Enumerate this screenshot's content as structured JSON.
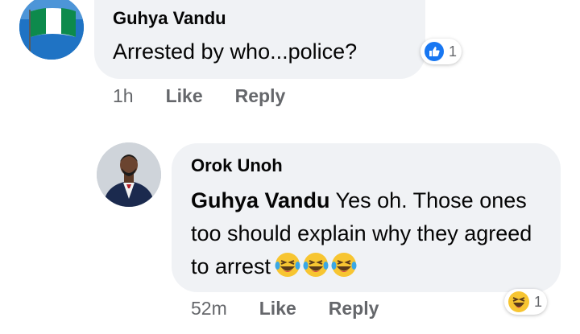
{
  "comments": [
    {
      "author": "Guhya Vandu",
      "text": "Arrested by who...police?",
      "reaction": {
        "type": "like-icon",
        "count": "1"
      },
      "time": "1h",
      "like_label": "Like",
      "reply_label": "Reply"
    },
    {
      "author": "Orok Unoh",
      "mention": "Guhya Vandu",
      "text": " Yes oh. Those ones too should explain why they agreed to arrest",
      "emojis": [
        "laughing-crying-emoji",
        "laughing-crying-emoji",
        "laughing-crying-emoji"
      ],
      "reaction": {
        "type": "haha-icon",
        "count": "1"
      },
      "time": "52m",
      "like_label": "Like",
      "reply_label": "Reply"
    }
  ],
  "colors": {
    "bubble": "#f0f2f5",
    "meta_text": "#65676b",
    "like_blue": "#1877f2",
    "nigeria_green": "#008751",
    "sky_blue": "#1f73c4"
  }
}
